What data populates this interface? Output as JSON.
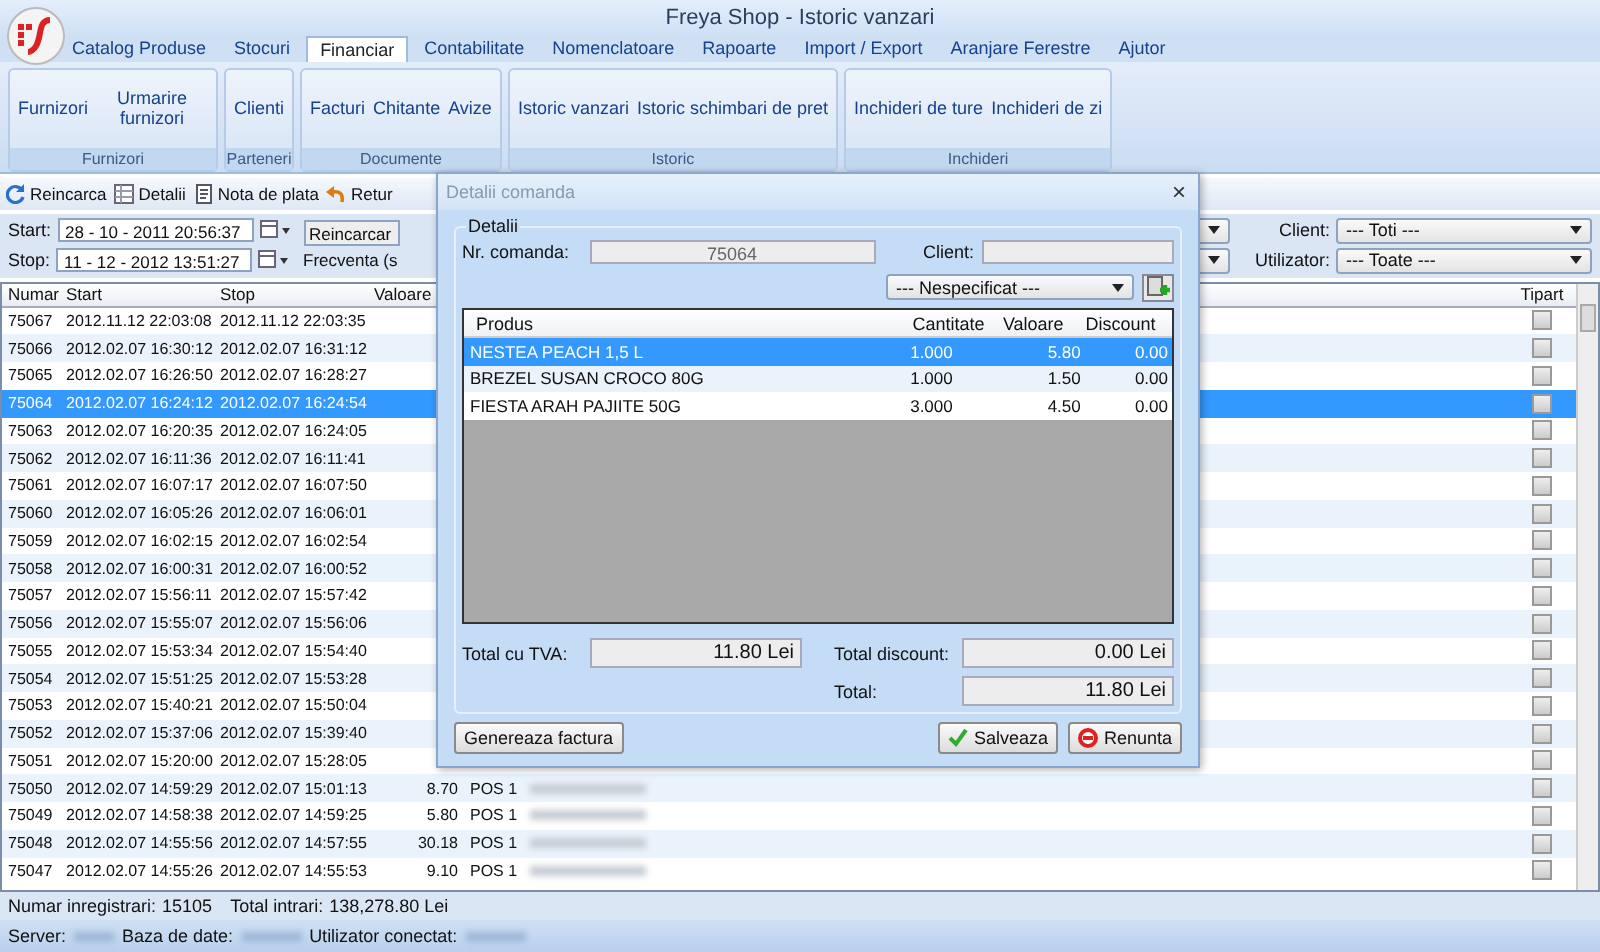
{
  "window": {
    "title": "Freya Shop - Istoric vanzari"
  },
  "menu_tabs": [
    {
      "label": "Catalog Produse",
      "selected": false
    },
    {
      "label": "Stocuri",
      "selected": false
    },
    {
      "label": "Financiar",
      "selected": true
    },
    {
      "label": "Contabilitate",
      "selected": false
    },
    {
      "label": "Nomenclatoare",
      "selected": false
    },
    {
      "label": "Rapoarte",
      "selected": false
    },
    {
      "label": "Import / Export",
      "selected": false
    },
    {
      "label": "Aranjare Ferestre",
      "selected": false
    },
    {
      "label": "Ajutor",
      "selected": false
    }
  ],
  "ribbon_groups": [
    {
      "label": "Furnizori",
      "items": [
        "Furnizori",
        "Urmarire furnizori"
      ]
    },
    {
      "label": "Parteneri",
      "items": [
        "Clienti"
      ]
    },
    {
      "label": "Documente",
      "items": [
        "Facturi",
        "Chitante",
        "Avize"
      ]
    },
    {
      "label": "Istoric",
      "items": [
        "Istoric vanzari",
        "Istoric schimbari de pret"
      ]
    },
    {
      "label": "Inchideri",
      "items": [
        "Inchideri de ture",
        "Inchideri de zi"
      ]
    }
  ],
  "toolbar": [
    {
      "kind": "reload",
      "label": "Reincarca"
    },
    {
      "kind": "details",
      "label": "Detalii"
    },
    {
      "kind": "receipt",
      "label": "Nota de plata"
    },
    {
      "kind": "return",
      "label": "Retur"
    }
  ],
  "filters": {
    "start_label": "Start:",
    "start_value": "28 - 10 - 2011 20:56:37",
    "stop_label": "Stop:",
    "stop_value": "11 - 12 - 2012 13:51:27",
    "reload_button": "Reincarcar",
    "frequency_label": "Frecventa (s",
    "client_label": "Client:",
    "client_value": "--- Toti ---",
    "user_label": "Utilizator:",
    "user_value": "--- Toate ---"
  },
  "table": {
    "columns": [
      "Numar",
      "Start",
      "Stop",
      "Valoare",
      "Tipart"
    ],
    "rows": [
      {
        "numar": "75067",
        "start": "2012.11.12 22:03:08",
        "stop": "2012.11.12 22:03:35",
        "selected": false,
        "tipart": false
      },
      {
        "numar": "75066",
        "start": "2012.02.07 16:30:12",
        "stop": "2012.02.07 16:31:12",
        "selected": false,
        "tipart": false
      },
      {
        "numar": "75065",
        "start": "2012.02.07 16:26:50",
        "stop": "2012.02.07 16:28:27",
        "selected": false,
        "tipart": false
      },
      {
        "numar": "75064",
        "start": "2012.02.07 16:24:12",
        "stop": "2012.02.07 16:24:54",
        "selected": true,
        "tipart": false
      },
      {
        "numar": "75063",
        "start": "2012.02.07 16:20:35",
        "stop": "2012.02.07 16:24:05",
        "selected": false,
        "tipart": false
      },
      {
        "numar": "75062",
        "start": "2012.02.07 16:11:36",
        "stop": "2012.02.07 16:11:41",
        "selected": false,
        "tipart": false
      },
      {
        "numar": "75061",
        "start": "2012.02.07 16:07:17",
        "stop": "2012.02.07 16:07:50",
        "selected": false,
        "tipart": false
      },
      {
        "numar": "75060",
        "start": "2012.02.07 16:05:26",
        "stop": "2012.02.07 16:06:01",
        "selected": false,
        "tipart": false
      },
      {
        "numar": "75059",
        "start": "2012.02.07 16:02:15",
        "stop": "2012.02.07 16:02:54",
        "selected": false,
        "tipart": false
      },
      {
        "numar": "75058",
        "start": "2012.02.07 16:00:31",
        "stop": "2012.02.07 16:00:52",
        "selected": false,
        "tipart": false
      },
      {
        "numar": "75057",
        "start": "2012.02.07 15:56:11",
        "stop": "2012.02.07 15:57:42",
        "selected": false,
        "tipart": false
      },
      {
        "numar": "75056",
        "start": "2012.02.07 15:55:07",
        "stop": "2012.02.07 15:56:06",
        "selected": false,
        "tipart": false
      },
      {
        "numar": "75055",
        "start": "2012.02.07 15:53:34",
        "stop": "2012.02.07 15:54:40",
        "selected": false,
        "tipart": false
      },
      {
        "numar": "75054",
        "start": "2012.02.07 15:51:25",
        "stop": "2012.02.07 15:53:28",
        "selected": false,
        "tipart": false
      },
      {
        "numar": "75053",
        "start": "2012.02.07 15:40:21",
        "stop": "2012.02.07 15:50:04",
        "selected": false,
        "tipart": false
      },
      {
        "numar": "75052",
        "start": "2012.02.07 15:37:06",
        "stop": "2012.02.07 15:39:40",
        "selected": false,
        "tipart": false
      },
      {
        "numar": "75051",
        "start": "2012.02.07 15:20:00",
        "stop": "2012.02.07 15:28:05",
        "selected": false,
        "tipart": false
      },
      {
        "numar": "75050",
        "start": "2012.02.07 14:59:29",
        "stop": "2012.02.07 15:01:13",
        "valoare": "8.70",
        "pos": "POS 1",
        "selected": false,
        "tipart": false
      },
      {
        "numar": "75049",
        "start": "2012.02.07 14:58:38",
        "stop": "2012.02.07 14:59:25",
        "valoare": "5.80",
        "pos": "POS 1",
        "selected": false,
        "tipart": false
      },
      {
        "numar": "75048",
        "start": "2012.02.07 14:55:56",
        "stop": "2012.02.07 14:57:55",
        "valoare": "30.18",
        "pos": "POS 1",
        "selected": false,
        "tipart": false
      },
      {
        "numar": "75047",
        "start": "2012.02.07 14:55:26",
        "stop": "2012.02.07 14:55:53",
        "valoare": "9.10",
        "pos": "POS 1",
        "selected": false,
        "tipart": false
      }
    ]
  },
  "status_bar": {
    "records_label": "Numar inregistrari:",
    "records": "15105",
    "total_label": "Total intrari:",
    "total": "138,278.80 Lei"
  },
  "footer": {
    "server_label": "Server:",
    "db_label": "Baza de date:",
    "user_label": "Utilizator conectat:"
  },
  "dialog": {
    "title": "Detalii comanda",
    "close": "×",
    "group": "Detalii",
    "order_label": "Nr. comanda:",
    "order_value": "75064",
    "client_label": "Client:",
    "type_value": "--- Nespecificat ---",
    "columns": [
      "Produs",
      "Cantitate",
      "Valoare",
      "Discount"
    ],
    "rows": [
      {
        "produs": "NESTEA PEACH 1,5 L",
        "cantitate": "1.000",
        "valoare": "5.80",
        "discount": "0.00",
        "selected": true
      },
      {
        "produs": "BREZEL SUSAN CROCO 80G",
        "cantitate": "1.000",
        "valoare": "1.50",
        "discount": "0.00",
        "selected": false
      },
      {
        "produs": "FIESTA ARAH PAJIITE 50G",
        "cantitate": "3.000",
        "valoare": "4.50",
        "discount": "0.00",
        "selected": false
      }
    ],
    "total_vat_label": "Total cu TVA:",
    "total_vat": "11.80 Lei",
    "total_discount_label": "Total discount:",
    "total_discount": "0.00 Lei",
    "total_label": "Total:",
    "total": "11.80 Lei",
    "buttons": [
      {
        "kind": "invoice",
        "label": "Genereaza factura"
      },
      {
        "kind": "save",
        "label": "Salveaza"
      },
      {
        "kind": "cancel",
        "label": "Renunta"
      }
    ]
  }
}
